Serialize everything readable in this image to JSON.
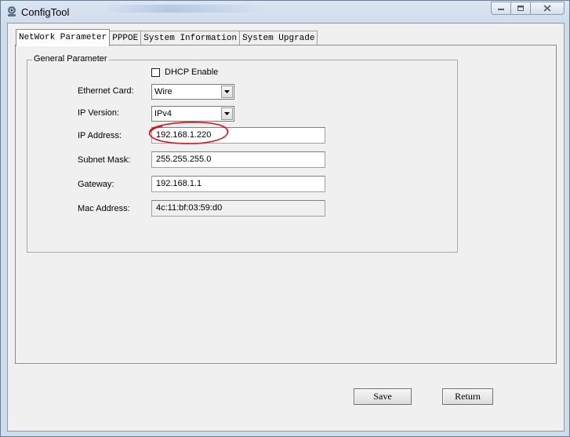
{
  "window": {
    "title": "ConfigTool"
  },
  "tabs": [
    {
      "label": "NetWork Parameter",
      "active": true
    },
    {
      "label": "PPPOE",
      "active": false
    },
    {
      "label": "System Information",
      "active": false
    },
    {
      "label": "System Upgrade",
      "active": false
    }
  ],
  "general": {
    "legend": "General Parameter",
    "dhcp": {
      "label": "DHCP Enable",
      "checked": false
    },
    "ethernet_card": {
      "label": "Ethernet Card:",
      "value": "Wire"
    },
    "ip_version": {
      "label": "IP Version:",
      "value": "IPv4"
    },
    "ip_address": {
      "label": "IP Address:",
      "value": "192.168.1.220"
    },
    "subnet_mask": {
      "label": "Subnet Mask:",
      "value": "255.255.255.0"
    },
    "gateway": {
      "label": "Gateway:",
      "value": "192.168.1.1"
    },
    "mac_address": {
      "label": "Mac Address:",
      "value": "4c:11:bf:03:59:d0"
    }
  },
  "buttons": {
    "save": "Save",
    "return": "Return"
  },
  "colors": {
    "annotation_circle": "#d8141c"
  }
}
